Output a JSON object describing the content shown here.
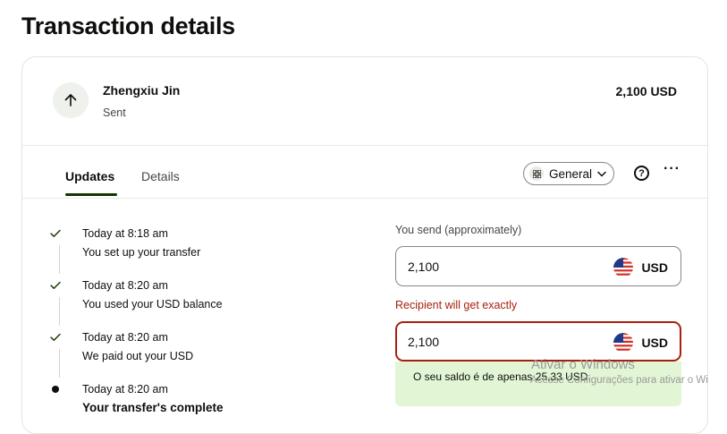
{
  "page": {
    "title": "Transaction details"
  },
  "transaction": {
    "recipient_name": "Zhengxiu Jin",
    "status": "Sent",
    "amount": "2,100 USD",
    "direction_icon": "arrow-up-icon"
  },
  "tabs": [
    {
      "label": "Updates",
      "active": true
    },
    {
      "label": "Details",
      "active": false
    }
  ],
  "toolbar": {
    "profile_label": "General",
    "profile_icon": "grid-icon",
    "help_icon": "help-circle-icon",
    "more_icon": "more-horizontal-icon"
  },
  "timeline": [
    {
      "state": "done",
      "time": "Today at 8:18 am",
      "description": "You set up your transfer"
    },
    {
      "state": "done",
      "time": "Today at 8:20 am",
      "description": "You used your USD balance"
    },
    {
      "state": "done",
      "time": "Today at 8:20 am",
      "description": "We paid out your USD"
    },
    {
      "state": "current",
      "time": "Today at 8:20 am",
      "description": "Your transfer's complete"
    }
  ],
  "form": {
    "send_label": "You send (approximately)",
    "send_value": "2,100",
    "send_currency": "USD",
    "receive_label": "Recipient will get exactly",
    "receive_value": "2,100",
    "receive_currency": "USD",
    "balance_hint": "O seu saldo é de apenas 25,33 USD."
  },
  "os_watermark": {
    "title": "Ativar o Windows",
    "subtitle": "Acesse Configurações para ativar o Wi"
  },
  "colors": {
    "text": "#0e0f0c",
    "muted": "#454745",
    "error": "#a8200d",
    "hint_bg": "#e2f6d5",
    "tab_underline": "#163300"
  }
}
